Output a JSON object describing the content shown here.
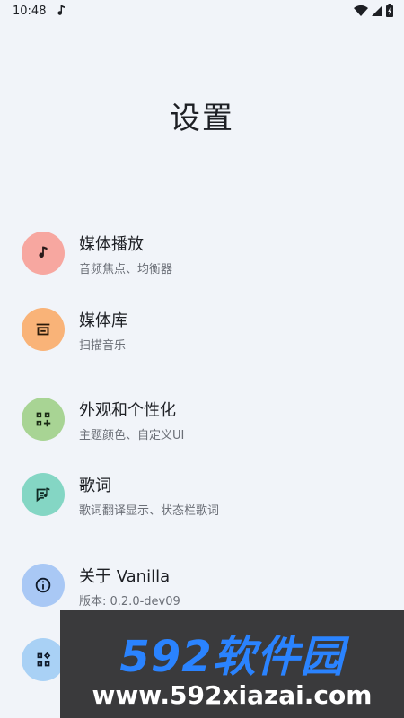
{
  "status_bar": {
    "time": "10:48"
  },
  "page": {
    "title": "设置"
  },
  "items": [
    {
      "title": "媒体播放",
      "subtitle": "音频焦点、均衡器",
      "icon": "music-note-icon",
      "color": "#f7a7a0"
    },
    {
      "title": "媒体库",
      "subtitle": "扫描音乐",
      "icon": "library-icon",
      "color": "#f9b378"
    },
    {
      "title": "外观和个性化",
      "subtitle": "主题颜色、自定义UI",
      "icon": "widgets-icon",
      "color": "#a8d494"
    },
    {
      "title": "歌词",
      "subtitle": "歌词翻译显示、状态栏歌词",
      "icon": "lyrics-icon",
      "color": "#84d6c4"
    },
    {
      "title": "关于 Vanilla",
      "subtitle": "版本: 0.2.0-dev09",
      "icon": "info-icon",
      "color": "#a9c8f5"
    },
    {
      "title": "",
      "subtitle": "",
      "icon": "extensions-icon",
      "color": "#a9d1f5"
    }
  ],
  "watermark": {
    "brand": "592软件园",
    "url": "www.592xiazai.com"
  }
}
